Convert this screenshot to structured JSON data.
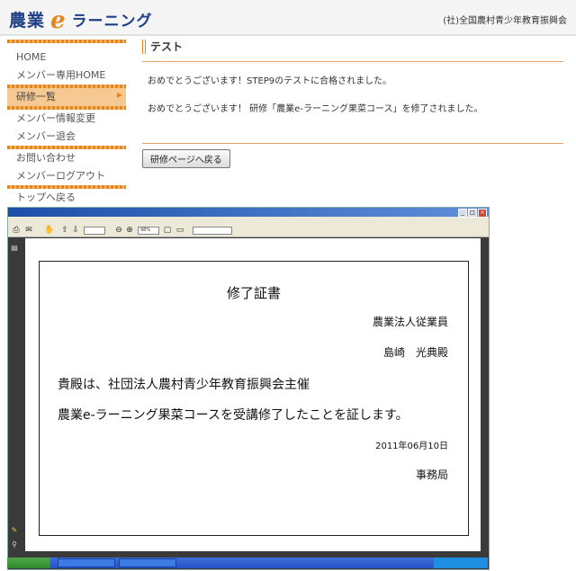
{
  "header": {
    "logo_main": "農業",
    "logo_e": "e",
    "logo_learning": "ラーニング",
    "org": "(社)全国農村青少年教育振興会"
  },
  "sidebar": {
    "items": [
      {
        "label": "HOME"
      },
      {
        "label": "メンバー専用HOME"
      },
      {
        "label": "研修一覧",
        "active": true
      },
      {
        "label": "メンバー情報変更"
      },
      {
        "label": "メンバー退会"
      },
      {
        "label": "お問い合わせ"
      },
      {
        "label": "メンバーログアウト"
      },
      {
        "label": "トップへ戻る"
      }
    ]
  },
  "main": {
    "title": "テスト",
    "message1": "おめでとうございます！STEP9のテストに合格されました。",
    "message2": "おめでとうございます！ 研修「農業e-ラーニング果菜コース」を修了されました。",
    "back_button": "研修ページへ戻る"
  },
  "pdf": {
    "zoom": "98%",
    "certificate": {
      "title": "修了証書",
      "recipient_line1": "農業法人従業員",
      "recipient_line2": "島崎　光典殿",
      "body_line1": "貴殿は、社団法人農村青少年教育振興会主催",
      "body_line2": "農業e-ラーニング果菜コースを受講修了したことを証します。",
      "date": "2011年06月10日",
      "issuer": "事務局"
    }
  },
  "colors": {
    "brand_blue": "#1e3f86",
    "accent_orange": "#e8861e",
    "active_nav_bg": "#f6c992"
  }
}
